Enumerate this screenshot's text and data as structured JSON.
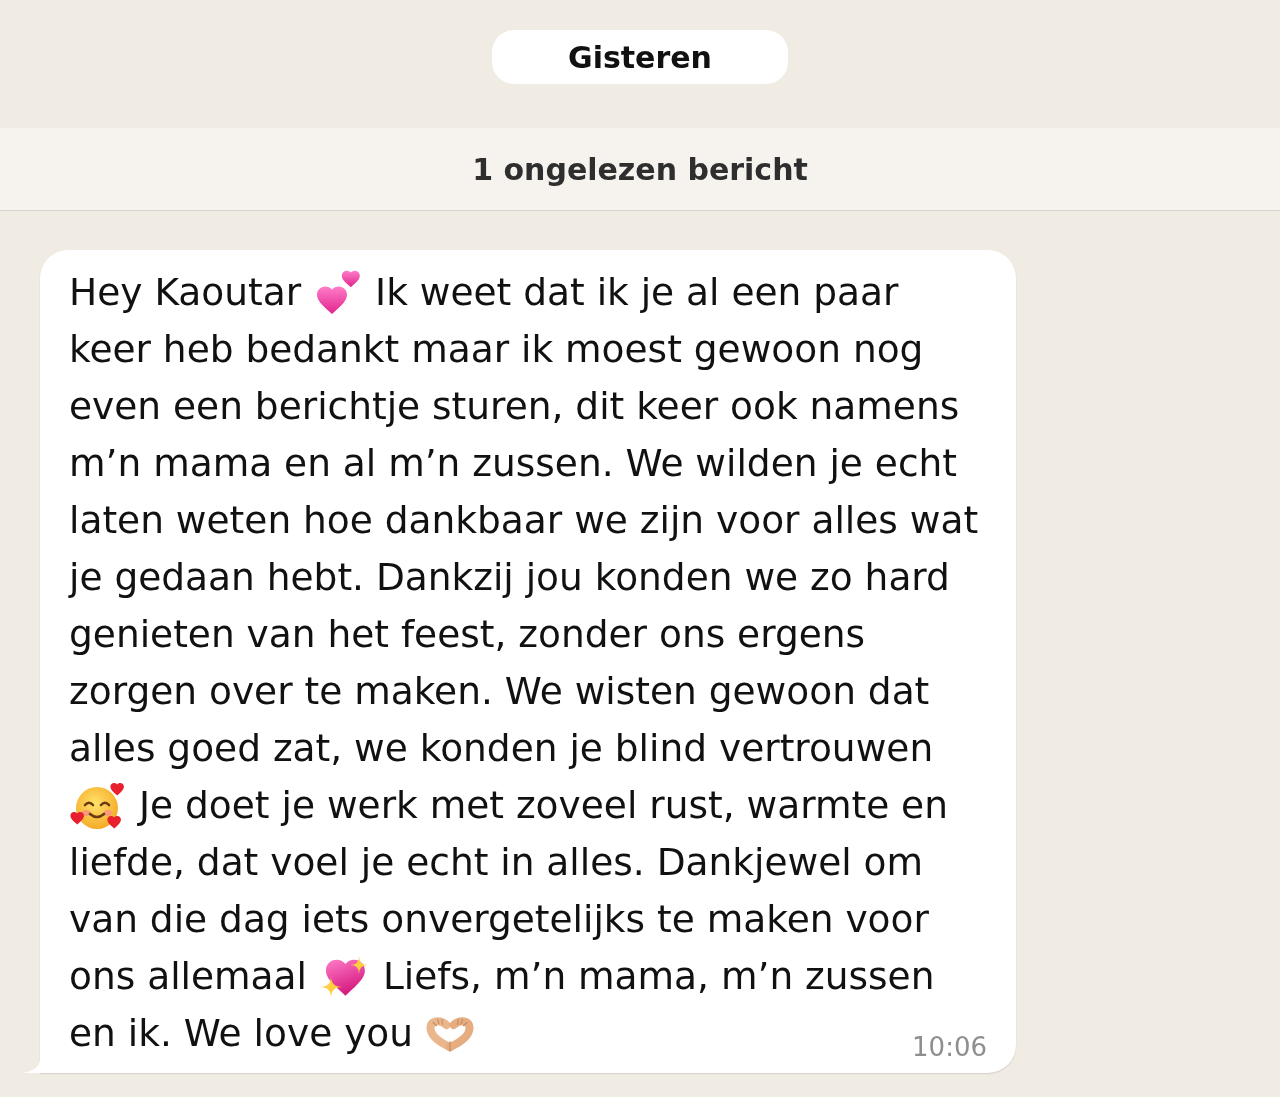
{
  "date_separator": {
    "label": "Gisteren"
  },
  "unread_banner": {
    "label": "1 ongelezen bericht"
  },
  "message": {
    "lines": [
      [
        {
          "kind": "text",
          "text": "Hey Kaoutar"
        },
        {
          "kind": "hearts"
        },
        {
          "kind": "text",
          "text": "Ik weet dat ik je al een paar"
        }
      ],
      [
        {
          "kind": "text",
          "text": "keer heb bedankt maar ik moest gewoon nog"
        }
      ],
      [
        {
          "kind": "text",
          "text": "even een berichtje sturen, dit keer ook namens"
        }
      ],
      [
        {
          "kind": "text",
          "text": "m’n mama en al m’n zussen. We wilden je echt"
        }
      ],
      [
        {
          "kind": "text",
          "text": "laten weten hoe dankbaar we zijn voor alles wat"
        }
      ],
      [
        {
          "kind": "text",
          "text": "je gedaan hebt. Dankzij jou konden we zo hard"
        }
      ],
      [
        {
          "kind": "text",
          "text": "genieten van het feest, zonder ons ergens"
        }
      ],
      [
        {
          "kind": "text",
          "text": "zorgen over te maken. We wisten gewoon dat"
        }
      ],
      [
        {
          "kind": "text",
          "text": "alles goed zat, we konden je blind vertrouwen"
        }
      ],
      [
        {
          "kind": "smiley"
        },
        {
          "kind": "text",
          "text": "Je doet je werk met zoveel rust, warmte en"
        }
      ],
      [
        {
          "kind": "text",
          "text": "liefde, dat voel je echt in alles. Dankjewel om"
        }
      ],
      [
        {
          "kind": "text",
          "text": "van die dag iets onvergetelijks te maken voor"
        }
      ],
      [
        {
          "kind": "text",
          "text": "ons allemaal"
        },
        {
          "kind": "sparkleheart"
        },
        {
          "kind": "text",
          "text": "Liefs, m’n mama, m’n zussen"
        }
      ],
      [
        {
          "kind": "text",
          "text": "en ik. We love you"
        },
        {
          "kind": "hearthands"
        }
      ]
    ],
    "time": "10:06"
  }
}
